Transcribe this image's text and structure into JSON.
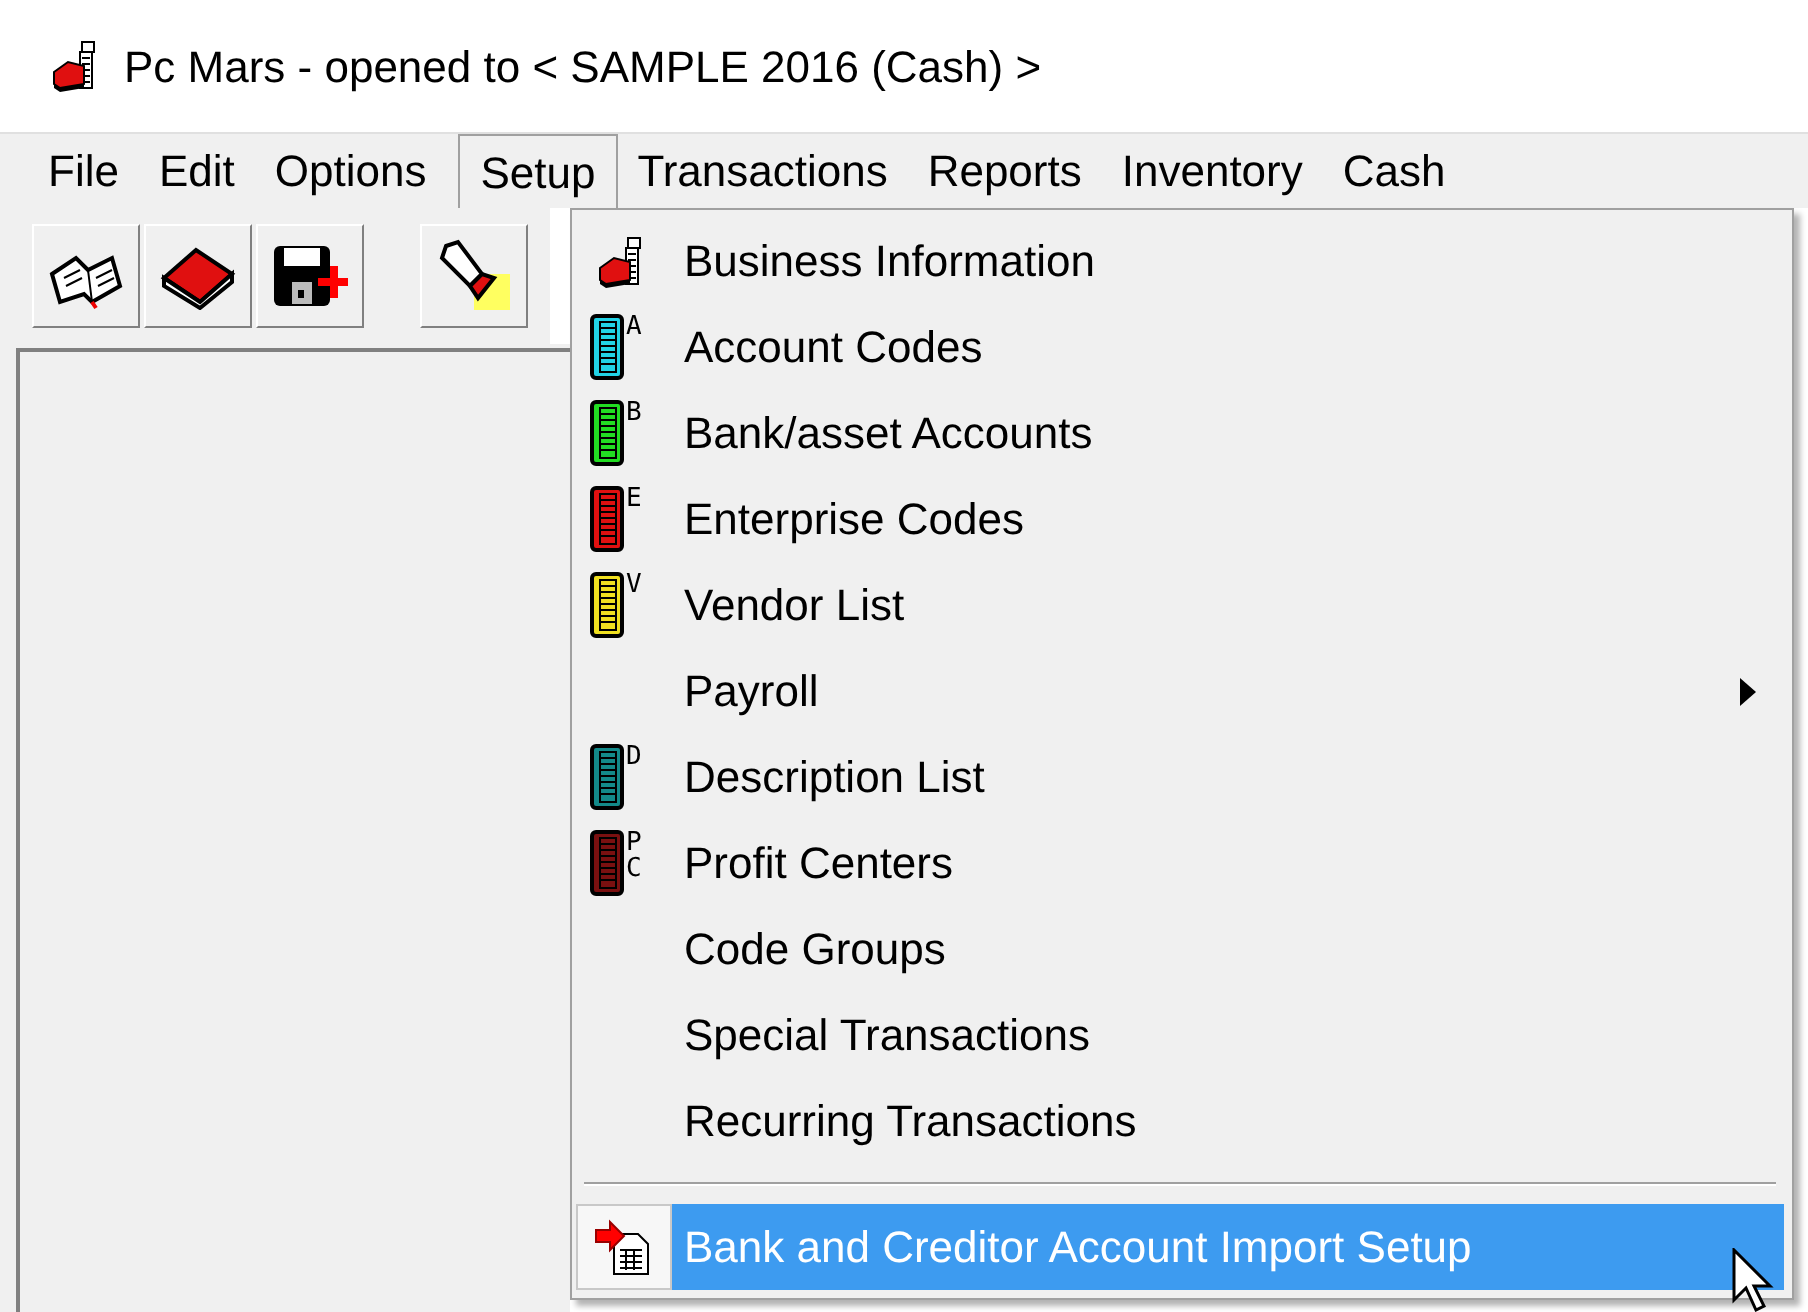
{
  "window": {
    "title": "Pc Mars - opened to < SAMPLE 2016 (Cash) >"
  },
  "menu_bar": [
    {
      "label": "File",
      "selected": false
    },
    {
      "label": "Edit",
      "selected": false
    },
    {
      "label": "Options",
      "selected": false
    },
    {
      "label": "Setup",
      "selected": true
    },
    {
      "label": "Transactions",
      "selected": false
    },
    {
      "label": "Reports",
      "selected": false
    },
    {
      "label": "Inventory",
      "selected": false
    },
    {
      "label": "Cash",
      "selected": false
    }
  ],
  "toolbar": [
    {
      "kind": "open-book"
    },
    {
      "kind": "closed-book"
    },
    {
      "kind": "save"
    },
    {
      "kind": "flashlight"
    }
  ],
  "setup_menu": [
    {
      "kind": "business",
      "label": "Business Information",
      "submenu": false,
      "selected": false
    },
    {
      "kind": "codebook",
      "color": "#22d3e6",
      "letters": [
        "A"
      ],
      "label": "Account Codes",
      "submenu": false,
      "selected": false
    },
    {
      "kind": "codebook",
      "color": "#22dd22",
      "letters": [
        "B"
      ],
      "label": "Bank/asset Accounts",
      "submenu": false,
      "selected": false
    },
    {
      "kind": "codebook",
      "color": "#e01010",
      "letters": [
        "E"
      ],
      "label": "Enterprise Codes",
      "submenu": false,
      "selected": false
    },
    {
      "kind": "codebook",
      "color": "#f0e020",
      "letters": [
        "V"
      ],
      "label": "Vendor List",
      "submenu": false,
      "selected": false
    },
    {
      "kind": "plain",
      "label": "Payroll",
      "submenu": true,
      "selected": false
    },
    {
      "kind": "codebook",
      "color": "#138a8a",
      "letters": [
        "D"
      ],
      "label": "Description List",
      "submenu": false,
      "selected": false
    },
    {
      "kind": "codebook",
      "color": "#7a1010",
      "letters": [
        "P",
        "C"
      ],
      "label": "Profit Centers",
      "submenu": false,
      "selected": false
    },
    {
      "kind": "plain",
      "label": "Code Groups",
      "submenu": false,
      "selected": false
    },
    {
      "kind": "plain",
      "label": "Special Transactions",
      "submenu": false,
      "selected": false
    },
    {
      "kind": "plain",
      "label": "Recurring Transactions",
      "submenu": false,
      "selected": false
    },
    {
      "kind": "separator"
    },
    {
      "kind": "import",
      "label": "Bank and Creditor Account Import Setup",
      "submenu": false,
      "selected": true
    }
  ]
}
